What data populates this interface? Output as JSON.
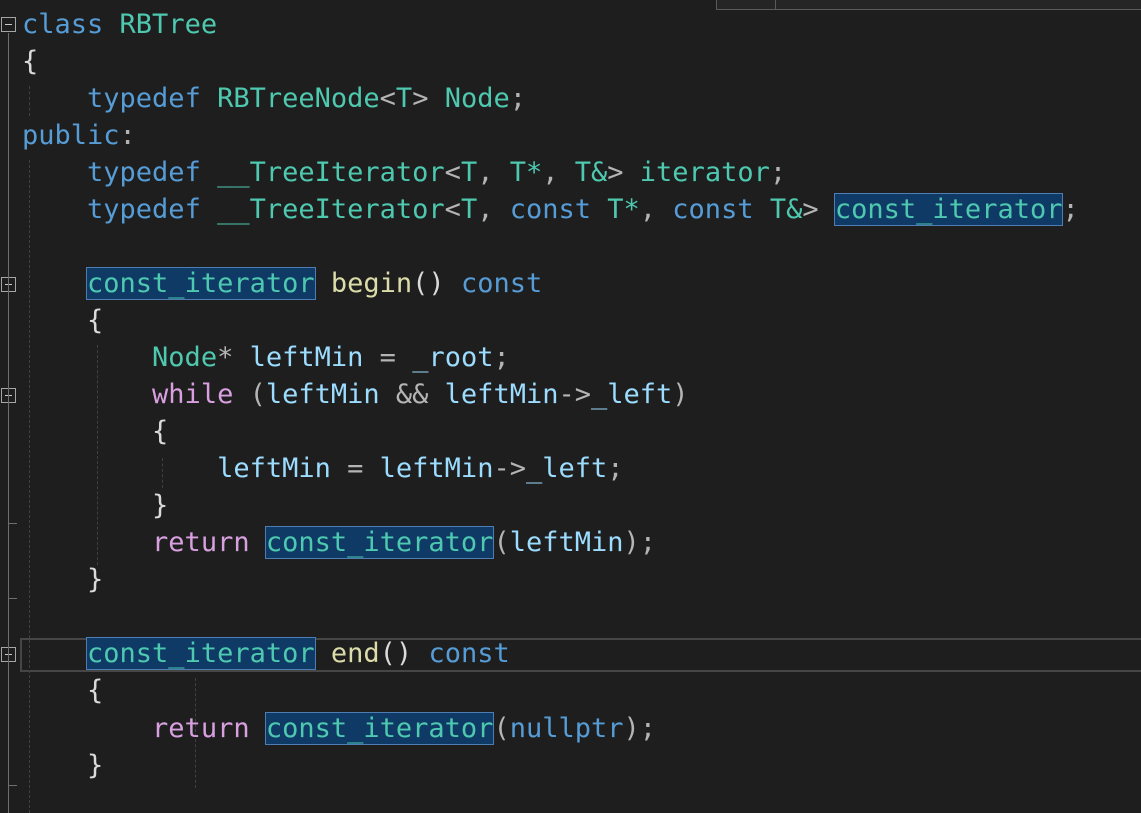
{
  "code": {
    "l1": {
      "kw": "class",
      "name": "RBTree"
    },
    "l2": {
      "brace": "{"
    },
    "l3": {
      "kw": "typedef",
      "t1": "RBTreeNode",
      "lt": "<",
      "tp": "T",
      "gt": ">",
      "alias": "Node",
      "semi": ";"
    },
    "l4": {
      "kw": "public",
      "colon": ":"
    },
    "l5": {
      "kw": "typedef",
      "t1": "__TreeIterator",
      "lt": "<",
      "a1": "T",
      "c1": ", ",
      "a2": "T*",
      "c2": ", ",
      "a3": "T&",
      "gt": ">",
      "alias": "iterator",
      "semi": ";"
    },
    "l6": {
      "kw": "typedef",
      "t1": "__TreeIterator",
      "lt": "<",
      "a1": "T",
      "c1": ", ",
      "const1": "const",
      "a2": "T*",
      "c2": ", ",
      "const2": "const",
      "a3": "T&",
      "gt": ">",
      "alias": "const_iterator",
      "semi": ";"
    },
    "l8": {
      "rtype": "const_iterator",
      "fn": "begin",
      "parens": "()",
      "const": "const"
    },
    "l9": {
      "brace": "{"
    },
    "l10": {
      "type": "Node",
      "star": "*",
      "var": "leftMin",
      "eq": " = ",
      "rhs": "_root",
      "semi": ";"
    },
    "l11": {
      "kw": "while",
      "open": " (",
      "v1": "leftMin",
      "and": " && ",
      "v2": "leftMin",
      "arrow": "->",
      "member": "_left",
      "close": ")"
    },
    "l12": {
      "brace": "{"
    },
    "l13": {
      "v1": "leftMin",
      "eq": " = ",
      "v2": "leftMin",
      "arrow": "->",
      "member": "_left",
      "semi": ";"
    },
    "l14": {
      "brace": "}"
    },
    "l15": {
      "kw": "return",
      "ctor": "const_iterator",
      "open": "(",
      "arg": "leftMin",
      "close": ");"
    },
    "l16": {
      "brace": "}"
    },
    "l18": {
      "rtype": "const_iterator",
      "fn": "end",
      "parens": "()",
      "const": "const"
    },
    "l19": {
      "brace": "{"
    },
    "l20": {
      "kw": "return",
      "ctor": "const_iterator",
      "open": "(",
      "arg": "nullptr",
      "close": ");"
    },
    "l21": {
      "brace": "}"
    }
  },
  "colors": {
    "background": "#1e1e1e",
    "keyword": "#569cd6",
    "control": "#d8a0df",
    "type": "#4ec9b0",
    "function": "#dcdcaa",
    "variable": "#9cdcfe",
    "highlight": "#0f3a66"
  }
}
